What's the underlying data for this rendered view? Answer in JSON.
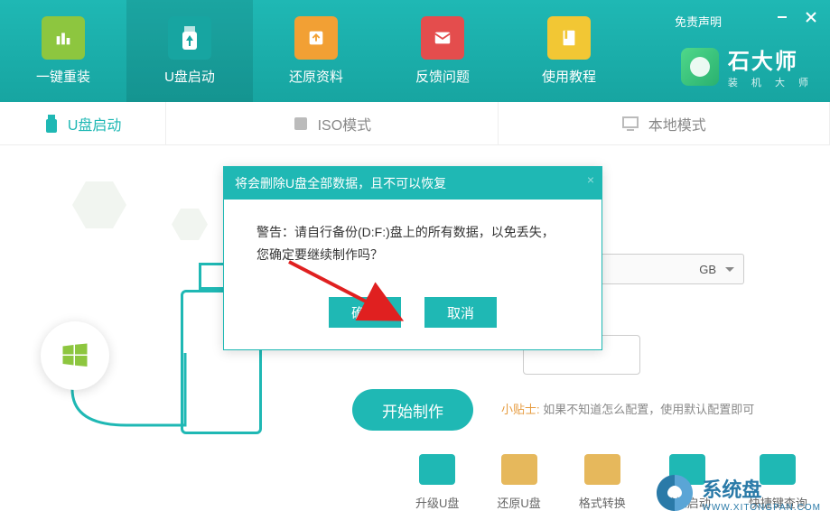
{
  "header": {
    "disclaimer": "免责声明",
    "nav": [
      {
        "label": "一键重装",
        "icon": "reinstall-icon"
      },
      {
        "label": "U盘启动",
        "icon": "usb-boot-icon"
      },
      {
        "label": "还原资料",
        "icon": "restore-icon"
      },
      {
        "label": "反馈问题",
        "icon": "feedback-icon"
      },
      {
        "label": "使用教程",
        "icon": "tutorial-icon"
      }
    ],
    "brand": {
      "title": "石大师",
      "subtitle": "装 机 大 师"
    }
  },
  "tabs": [
    {
      "label": "U盘启动",
      "active": true
    },
    {
      "label": "ISO模式",
      "active": false
    },
    {
      "label": "本地模式",
      "active": false
    }
  ],
  "main": {
    "dropdown_suffix": "GB",
    "start_button": "开始制作",
    "tip_label": "小贴士:",
    "tip_text": "如果不知道怎么配置，使用默认配置即可"
  },
  "tools": [
    {
      "label": "升级U盘"
    },
    {
      "label": "还原U盘"
    },
    {
      "label": "格式转换"
    },
    {
      "label": "模拟启动"
    },
    {
      "label": "快捷键查询"
    }
  ],
  "dialog": {
    "title": "将会删除U盘全部数据，且不可以恢复",
    "warning_line1": "警告：请自行备份(D:F:)盘上的所有数据，以免丢失，",
    "warning_line2": "您确定要继续制作吗？",
    "ok": "确定",
    "cancel": "取消"
  },
  "watermark": {
    "title": "系统盘",
    "url": "WWW.XITONGPAN.COM"
  }
}
